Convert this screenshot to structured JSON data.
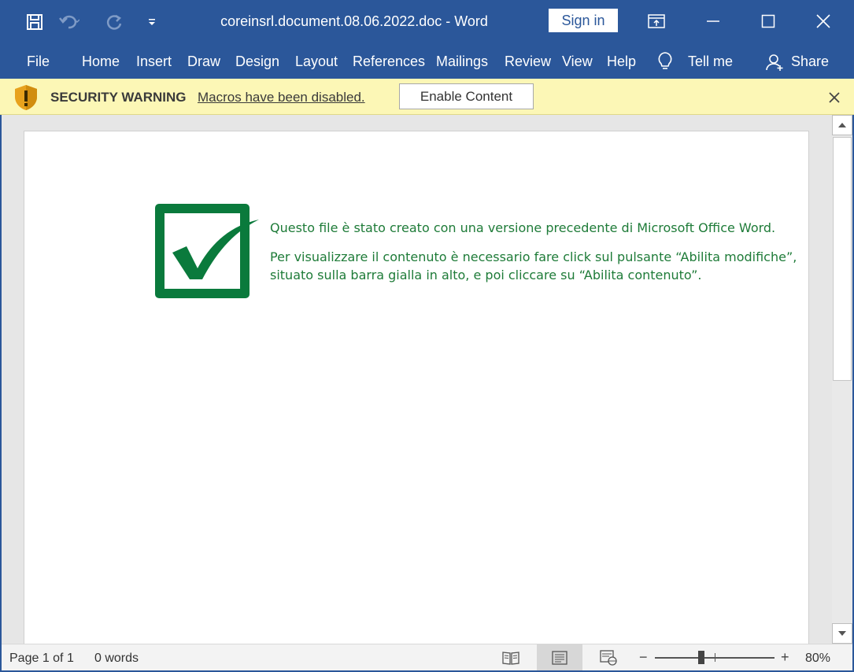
{
  "window": {
    "title": "coreinsrl.document.08.06.2022.doc  -  Word",
    "sign_in_label": "Sign in",
    "accent_color": "#2b579a"
  },
  "ribbon": {
    "tabs": [
      {
        "label": "File"
      },
      {
        "label": "Home"
      },
      {
        "label": "Insert"
      },
      {
        "label": "Draw"
      },
      {
        "label": "Design"
      },
      {
        "label": "Layout"
      },
      {
        "label": "References"
      },
      {
        "label": "Mailings"
      },
      {
        "label": "Review"
      },
      {
        "label": "View"
      },
      {
        "label": "Help"
      }
    ],
    "tell_me_label": "Tell me",
    "share_label": "Share"
  },
  "security_bar": {
    "title": "SECURITY WARNING",
    "message": "Macros have been disabled.",
    "enable_label": "Enable Content",
    "background_color": "#fcf7b6"
  },
  "document": {
    "line1": "Questo file è stato creato con una versione precedente di Microsoft Office Word.",
    "line2a": "Per visualizzare il contenuto è necessario fare click sul pulsante “Abilita modifiche”,",
    "line2b": "situato sulla barra gialla in alto, e poi cliccare su “Abilita contenuto”.",
    "text_color": "#1e7b38"
  },
  "status_bar": {
    "page_info": "Page 1 of 1",
    "word_count": "0 words",
    "zoom_level": "80%",
    "zoom_minus": "−",
    "zoom_plus": "+"
  },
  "icons": [
    "save-icon",
    "undo-icon",
    "redo-icon",
    "customize-qat-icon",
    "ribbon-display-icon",
    "minimize-icon",
    "maximize-icon",
    "close-icon",
    "lightbulb-icon",
    "share-person-icon",
    "warning-shield-icon",
    "close-bar-icon",
    "read-mode-icon",
    "print-layout-icon",
    "web-layout-icon"
  ]
}
